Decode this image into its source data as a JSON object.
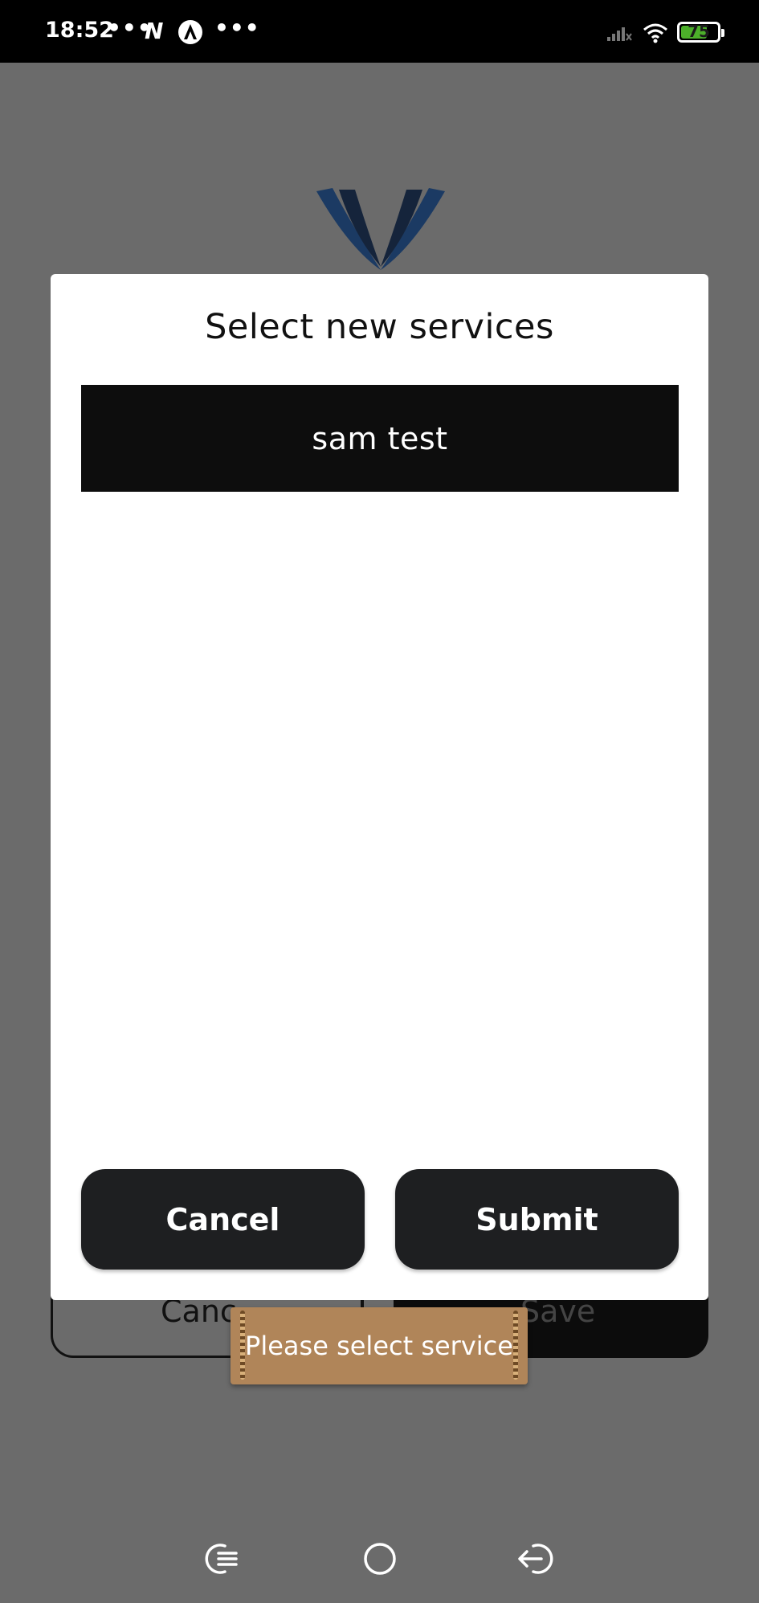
{
  "status_bar": {
    "time": "18:52",
    "dots_left": "•••",
    "n_glyph": "N",
    "dots_right": "•••",
    "battery_level": "75",
    "battery_fraction": 0.75,
    "battery_color": "#4caf2a"
  },
  "dialog": {
    "title": "Select new services",
    "services": [
      "sam test"
    ],
    "cancel_label": "Cancel",
    "submit_label": "Submit"
  },
  "background_app": {
    "cancel_label": "Canc",
    "save_label": "Save",
    "logo_color": "#1b3a63"
  },
  "toast": {
    "message": "Please select service",
    "color": "#b08559"
  },
  "nav_bar": {
    "recent_icon": "recent-apps-icon",
    "home_icon": "home-icon",
    "back_icon": "back-icon"
  }
}
